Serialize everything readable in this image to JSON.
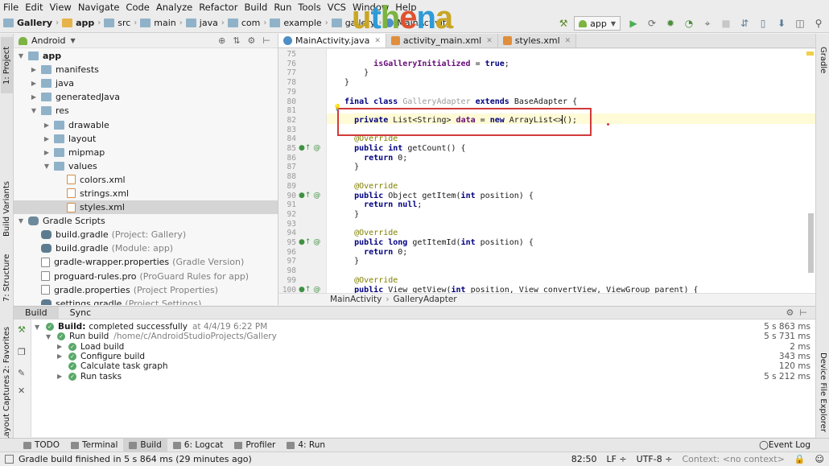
{
  "menu": [
    "File",
    "Edit",
    "View",
    "Navigate",
    "Code",
    "Analyze",
    "Refactor",
    "Build",
    "Run",
    "Tools",
    "VCS",
    "Window",
    "Help"
  ],
  "breadcrumbs": [
    "Gallery",
    "app",
    "src",
    "main",
    "java",
    "com",
    "example",
    "gallery",
    "MainActivity"
  ],
  "watermark": "uthena",
  "run_config": "app",
  "colors": {
    "accent_red": "#d13a3a",
    "success_green": "#59a869",
    "android_green": "#7cb342"
  },
  "left_tabs": [
    "1: Project",
    "Build Variants",
    "7: Structure",
    "2: Favorites",
    "Layout Captures"
  ],
  "right_tabs": [
    "Gradle",
    "Device File Explorer"
  ],
  "project": {
    "view_mode": "Android",
    "tree": [
      {
        "label": "app",
        "note": "",
        "indent": 0,
        "icon": "folder-app-icon",
        "expanded": true
      },
      {
        "label": "manifests",
        "note": "",
        "indent": 1,
        "icon": "folder-icon",
        "expanded": false
      },
      {
        "label": "java",
        "note": "",
        "indent": 1,
        "icon": "folder-icon",
        "expanded": false
      },
      {
        "label": "generatedJava",
        "note": "",
        "indent": 1,
        "icon": "folder-icon",
        "expanded": false
      },
      {
        "label": "res",
        "note": "",
        "indent": 1,
        "icon": "folder-icon",
        "expanded": true
      },
      {
        "label": "drawable",
        "note": "",
        "indent": 2,
        "icon": "folder-icon",
        "expanded": false
      },
      {
        "label": "layout",
        "note": "",
        "indent": 2,
        "icon": "folder-icon",
        "expanded": false
      },
      {
        "label": "mipmap",
        "note": "",
        "indent": 2,
        "icon": "folder-icon",
        "expanded": false
      },
      {
        "label": "values",
        "note": "",
        "indent": 2,
        "icon": "folder-icon",
        "expanded": true
      },
      {
        "label": "colors.xml",
        "note": "",
        "indent": 3,
        "icon": "xml-file-icon",
        "expanded": null
      },
      {
        "label": "strings.xml",
        "note": "",
        "indent": 3,
        "icon": "xml-file-icon",
        "expanded": null
      },
      {
        "label": "styles.xml",
        "note": "",
        "indent": 3,
        "icon": "xml-file-icon",
        "expanded": null,
        "selected": true
      },
      {
        "label": "Gradle Scripts",
        "note": "",
        "indent": 0,
        "icon": "gradle-scripts-icon",
        "expanded": true
      },
      {
        "label": "build.gradle",
        "note": "(Project: Gallery)",
        "indent": 1,
        "icon": "gradle-file-icon",
        "expanded": null
      },
      {
        "label": "build.gradle",
        "note": "(Module: app)",
        "indent": 1,
        "icon": "gradle-file-icon",
        "expanded": null
      },
      {
        "label": "gradle-wrapper.properties",
        "note": "(Gradle Version)",
        "indent": 1,
        "icon": "properties-file-icon",
        "expanded": null
      },
      {
        "label": "proguard-rules.pro",
        "note": "(ProGuard Rules for app)",
        "indent": 1,
        "icon": "proguard-file-icon",
        "expanded": null
      },
      {
        "label": "gradle.properties",
        "note": "(Project Properties)",
        "indent": 1,
        "icon": "properties-file-icon",
        "expanded": null
      },
      {
        "label": "settings.gradle",
        "note": "(Project Settings)",
        "indent": 1,
        "icon": "gradle-file-icon",
        "expanded": null
      }
    ]
  },
  "editor": {
    "tabs": [
      {
        "label": "MainActivity.java",
        "icon": "java-class-icon",
        "active": true
      },
      {
        "label": "activity_main.xml",
        "icon": "xml-file-icon",
        "active": false
      },
      {
        "label": "styles.xml",
        "icon": "xml-file-icon",
        "active": false
      }
    ],
    "lines": [
      {
        "n": "75",
        "html": ""
      },
      {
        "n": "76",
        "html": "        <span class='fld'>isGalleryInitialized</span> = <span class='kw'>true</span>;"
      },
      {
        "n": "77",
        "html": "      }"
      },
      {
        "n": "78",
        "html": "  }"
      },
      {
        "n": "79",
        "html": ""
      },
      {
        "n": "80",
        "html": "  <span class='kw'>final class</span> <span class='gr'>GalleryAdapter</span> <span class='kw'>extends</span> BaseAdapter {"
      },
      {
        "n": "81",
        "html": ""
      },
      {
        "n": "82",
        "html": "    <span class='kw'>private</span> List&lt;String&gt; <span class='fld'>data</span> = <span class='kw'>new</span> ArrayList&lt;&gt;();"
      },
      {
        "n": "83",
        "html": ""
      },
      {
        "n": "84",
        "html": "    <span class='an'>@Override</span>"
      },
      {
        "n": "85",
        "html": "    <span class='kw'>public int</span> getCount() {"
      },
      {
        "n": "86",
        "html": "      <span class='kw'>return</span> 0;"
      },
      {
        "n": "87",
        "html": "    }"
      },
      {
        "n": "88",
        "html": ""
      },
      {
        "n": "89",
        "html": "    <span class='an'>@Override</span>"
      },
      {
        "n": "90",
        "html": "    <span class='kw'>public</span> Object getItem(<span class='kw'>int</span> position) {"
      },
      {
        "n": "91",
        "html": "      <span class='kw'>return null</span>;"
      },
      {
        "n": "92",
        "html": "    }"
      },
      {
        "n": "93",
        "html": ""
      },
      {
        "n": "94",
        "html": "    <span class='an'>@Override</span>"
      },
      {
        "n": "95",
        "html": "    <span class='kw'>public long</span> getItemId(<span class='kw'>int</span> position) {"
      },
      {
        "n": "96",
        "html": "      <span class='kw'>return</span> 0;"
      },
      {
        "n": "97",
        "html": "    }"
      },
      {
        "n": "98",
        "html": ""
      },
      {
        "n": "99",
        "html": "    <span class='an'>@Override</span>"
      },
      {
        "n": "100",
        "html": "    <span class='kw'>public</span> View getView(<span class='kw'>int</span> position, View convertView, ViewGroup parent) {"
      }
    ],
    "override_lines": [
      "85",
      "90",
      "95",
      "100"
    ],
    "breadcrumb": [
      "MainActivity",
      "GalleryAdapter"
    ]
  },
  "build": {
    "tabs": [
      "Build",
      "Sync"
    ],
    "rows": [
      {
        "label": "Build:",
        "extra": "completed successfully",
        "note": "at 4/4/19 6:22 PM",
        "level": 0,
        "arrow": "down",
        "time": "5 s 863 ms",
        "bold": true
      },
      {
        "label": "Run build",
        "extra": "",
        "note": "/home/c/AndroidStudioProjects/Gallery",
        "level": 1,
        "arrow": "down",
        "time": "5 s 731 ms",
        "bold": false
      },
      {
        "label": "Load build",
        "extra": "",
        "note": "",
        "level": 2,
        "arrow": "right",
        "time": "2 ms",
        "bold": false
      },
      {
        "label": "Configure build",
        "extra": "",
        "note": "",
        "level": 2,
        "arrow": "right",
        "time": "343 ms",
        "bold": false
      },
      {
        "label": "Calculate task graph",
        "extra": "",
        "note": "",
        "level": 2,
        "arrow": "",
        "time": "120 ms",
        "bold": false
      },
      {
        "label": "Run tasks",
        "extra": "",
        "note": "",
        "level": 2,
        "arrow": "right",
        "time": "5 s 212 ms",
        "bold": false
      }
    ]
  },
  "tool_windows": [
    "TODO",
    "Terminal",
    "Build",
    "6: Logcat",
    "Profiler",
    "4: Run"
  ],
  "event_log": "Event Log",
  "status": {
    "message": "Gradle build finished in 5 s 864 ms (29 minutes ago)",
    "position": "82:50",
    "line_sep": "LF ÷",
    "encoding": "UTF-8 ÷",
    "context": "Context: <no context>"
  }
}
